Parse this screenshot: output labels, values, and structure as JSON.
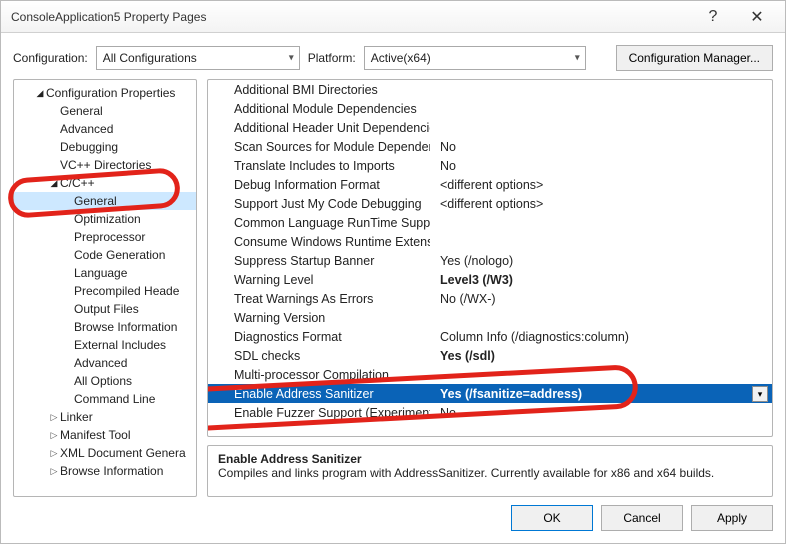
{
  "window": {
    "title": "ConsoleApplication5 Property Pages",
    "help_glyph": "?",
    "close_glyph": "✕"
  },
  "top": {
    "config_label": "Configuration:",
    "config_value": "All Configurations",
    "platform_label": "Platform:",
    "platform_value": "Active(x64)",
    "cfg_manager": "Configuration Manager..."
  },
  "tree": {
    "root": "Configuration Properties",
    "items1": [
      "General",
      "Advanced",
      "Debugging",
      "VC++ Directories"
    ],
    "cpp": "C/C++",
    "cpp_items": [
      "General",
      "Optimization",
      "Preprocessor",
      "Code Generation",
      "Language",
      "Precompiled Heade",
      "Output Files",
      "Browse Information",
      "External Includes",
      "Advanced",
      "All Options",
      "Command Line"
    ],
    "items2": [
      "Linker",
      "Manifest Tool",
      "XML Document Genera",
      "Browse Information"
    ]
  },
  "grid": [
    {
      "label": "Additional BMI Directories",
      "value": ""
    },
    {
      "label": "Additional Module Dependencies",
      "value": ""
    },
    {
      "label": "Additional Header Unit Dependencies",
      "value": ""
    },
    {
      "label": "Scan Sources for Module Dependencies",
      "value": "No"
    },
    {
      "label": "Translate Includes to Imports",
      "value": "No"
    },
    {
      "label": "Debug Information Format",
      "value": "<different options>"
    },
    {
      "label": "Support Just My Code Debugging",
      "value": "<different options>"
    },
    {
      "label": "Common Language RunTime Support",
      "value": ""
    },
    {
      "label": "Consume Windows Runtime Extension",
      "value": ""
    },
    {
      "label": "Suppress Startup Banner",
      "value": "Yes (/nologo)"
    },
    {
      "label": "Warning Level",
      "value": "Level3 (/W3)",
      "bold": true
    },
    {
      "label": "Treat Warnings As Errors",
      "value": "No (/WX-)"
    },
    {
      "label": "Warning Version",
      "value": ""
    },
    {
      "label": "Diagnostics Format",
      "value": "Column Info (/diagnostics:column)"
    },
    {
      "label": "SDL checks",
      "value": "Yes (/sdl)",
      "bold": true
    },
    {
      "label": "Multi-processor Compilation",
      "value": ""
    },
    {
      "label": "Enable Address Sanitizer",
      "value": "Yes (/fsanitize=address)",
      "bold": true,
      "selected": true
    },
    {
      "label": "Enable Fuzzer Support (Experimental)",
      "value": "No"
    }
  ],
  "desc": {
    "title": "Enable Address Sanitizer",
    "body": "Compiles and links program with AddressSanitizer. Currently available for x86 and x64 builds."
  },
  "buttons": {
    "ok": "OK",
    "cancel": "Cancel",
    "apply": "Apply"
  }
}
